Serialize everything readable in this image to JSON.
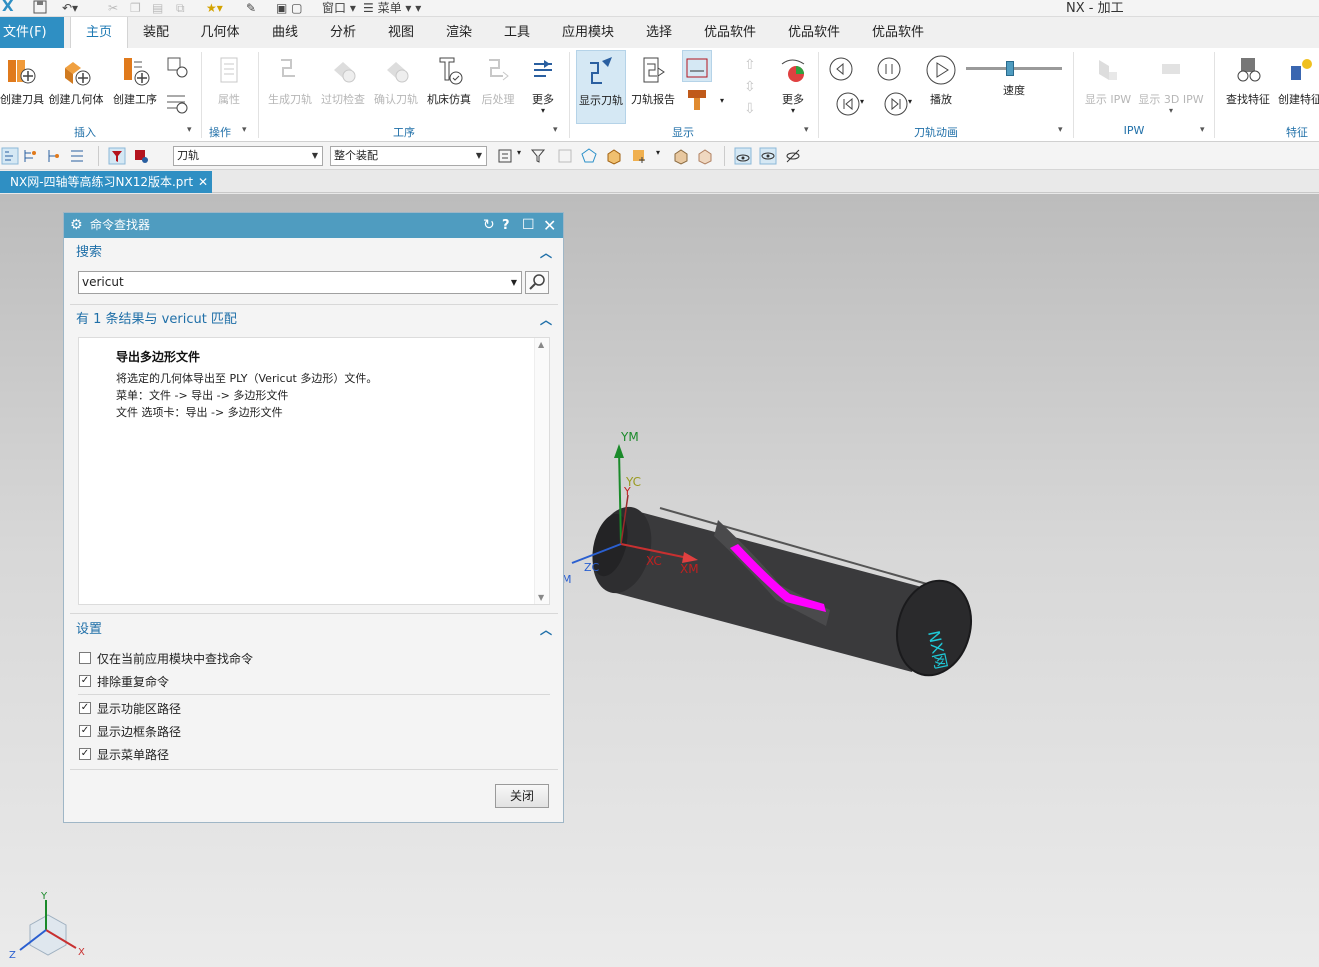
{
  "window": {
    "title": "NX - 加工",
    "quick_access": {
      "window_label": "窗口",
      "menu_label": "菜单"
    }
  },
  "menu": {
    "file": "文件(F)"
  },
  "tabs": [
    "主页",
    "装配",
    "几何体",
    "曲线",
    "分析",
    "视图",
    "渲染",
    "工具",
    "应用模块",
    "选择",
    "优品软件",
    "优品软件",
    "优品软件"
  ],
  "ribbon": {
    "insert": {
      "create_tool": "创建刀具",
      "create_geometry": "创建几何体",
      "create_operation": "创建工序",
      "group": "插入"
    },
    "operate": {
      "properties": "属性",
      "group": "操作"
    },
    "operation": {
      "generate_toolpath": "生成刀轨",
      "gouge_check": "过切检查",
      "verify_toolpath": "确认刀轨",
      "machine_sim": "机床仿真",
      "postprocess": "后处理",
      "more": "更多",
      "group": "工序"
    },
    "display": {
      "show_toolpath": "显示刀轨",
      "toolpath_report": "刀轨报告",
      "more": "更多",
      "group": "显示"
    },
    "animation": {
      "play": "播放",
      "speed": "速度",
      "group": "刀轨动画"
    },
    "ipw": {
      "show_ipw": "显示 IPW",
      "show_3d_ipw": "显示 3D IPW",
      "group": "IPW"
    },
    "feature": {
      "find_feature": "查找特征",
      "create_feature": "创建特征",
      "group": "特征"
    }
  },
  "selection_bar": {
    "filter": "刀轨",
    "scope": "整个装配"
  },
  "document": {
    "tab_label": "NX网-四轴等高练习NX12版本.prt"
  },
  "dialog": {
    "title": "命令查找器",
    "search": {
      "header": "搜索",
      "query": "vericut"
    },
    "results": {
      "header": "有 1 条结果与 vericut 匹配",
      "items": [
        {
          "title": "导出多边形文件",
          "lines": [
            "将选定的几何体导出至 PLY（Vericut 多边形）文件。",
            "菜单：文件 -> 导出 -> 多边形文件",
            "文件 选项卡：导出 -> 多边形文件"
          ]
        }
      ]
    },
    "settings": {
      "header": "设置",
      "options": [
        {
          "label": "仅在当前应用模块中查找命令",
          "checked": false
        },
        {
          "label": "排除重复命令",
          "checked": true
        },
        {
          "label": "显示功能区路径",
          "checked": true
        },
        {
          "label": "显示边框条路径",
          "checked": true
        },
        {
          "label": "显示菜单路径",
          "checked": true
        }
      ]
    },
    "close_label": "关闭"
  },
  "viewport": {
    "axes": {
      "ym": "YM",
      "yc": "YC",
      "xc": "XC",
      "xm": "XM",
      "zc": "ZC",
      "y": "Y",
      "m": "M"
    },
    "triad": {
      "x": "X",
      "y": "Y",
      "z": "Z"
    },
    "engraving": "NX网"
  },
  "colors": {
    "accent": "#2f8fc3",
    "dialog_title": "#4f9cc0",
    "toolpath": "#ff00ff",
    "part": "#3a3a3c",
    "engraving": "#1fc8d6"
  }
}
